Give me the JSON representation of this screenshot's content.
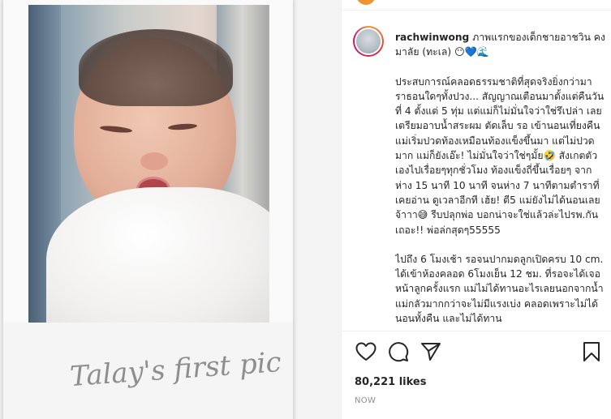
{
  "post": {
    "image_caption_handwritten": "Talay's first pic",
    "author": {
      "username": "rachwinwong"
    },
    "caption_headline": "ภาพแรกของเด็กชายอาชวิน คงมาลัย (ทะเล) 😶💙🌊",
    "caption_body_1": "ประสบการณ์คลอดธรรมชาติที่สุดจริงยิ่งกว่ามาราธอนใดๆทั้งปวง... สัญญาณเตือนมาตั้งแต่คืนวันที่ 4 ตั้งแต่ 5 ทุ่ม แต่แม่ก็ไม่มั่นใจว่าใช่รึเปล่า เลยเตรียมอาบน้ำสระผม ตัดเล็บ รอ เข้านอนเที่ยงคืน แม่เริ่มปวดท้องเหมือนท้องแข็งขึ้นมา แต่ไม่ปวดมาก แม่ก็ยังเอ๊ะ! ไม่มั่นใจว่าใช่ๆมั้ย🤣 สังเกตตัวเองไปเรื่อยๆทุกชั่วโมง ท้องแข็งถี่ขึ้นเรื่อยๆ จากห่าง 15 นาที 10 นาที จนห่าง 7 นาทีตามตำราที่เคยอ่าน ดูเวลาอีกที เฮ้ย! ตี5 แม่ยังไม่ได้นอนเลยจ้าาา😅 รีบปลุกพ่อ บอกน่าจะใช่แล้วล่ะไปรพ.กันเถอะ!! พ่อล่กสุดๆ55555",
    "caption_body_2": "ไปถึง 6 โมงเช้า รอจนปากมดลูกเปิดครบ 10 cm. ได้เข้าห้องคลอด 6โมงเย็น 12 ชม. ที่รอจะได้เจอหน้าลูกครั้งแรก แม่ไม่ได้ทานอะไรเลยนอกจากน้ำ แม่กลัวมากกว่าจะไม่มีแรงเบ่ง คลอดเพราะไม่ได้นอนทั้งคืน และไม่ได้ทาน",
    "likes": "80,221 likes",
    "timestamp": "NOW"
  },
  "icons": {
    "like": "heart-icon",
    "comment": "comment-icon",
    "share": "share-icon",
    "save": "bookmark-icon"
  },
  "colors": {
    "text": "#262626",
    "muted": "#8e8e8e",
    "divider": "#efefef"
  }
}
